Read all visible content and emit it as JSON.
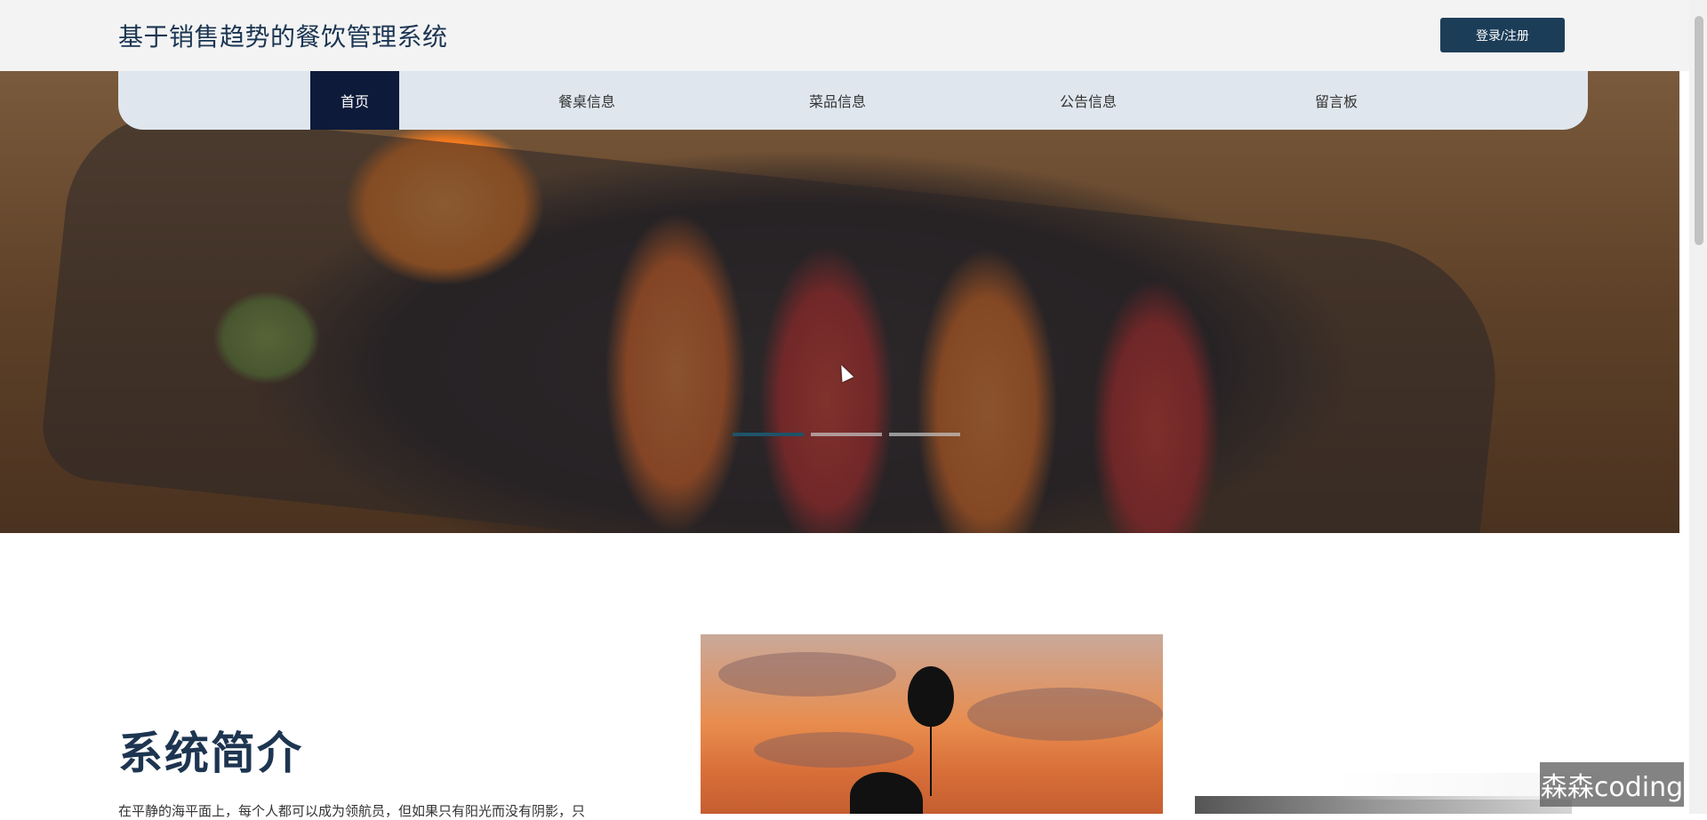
{
  "header": {
    "title": "基于销售趋势的餐饮管理系统",
    "login_label": "登录/注册"
  },
  "nav": {
    "items": [
      {
        "label": "首页",
        "active": true
      },
      {
        "label": "餐桌信息",
        "active": false
      },
      {
        "label": "菜品信息",
        "active": false
      },
      {
        "label": "公告信息",
        "active": false
      },
      {
        "label": "留言板",
        "active": false
      }
    ]
  },
  "carousel": {
    "slide_count": 3,
    "active_index": 0
  },
  "intro": {
    "title": "系统简介",
    "text": "在平静的海平面上，每个人都可以成为领航员，但如果只有阳光而没有阴影，只"
  },
  "watermark": {
    "text": "森森coding"
  },
  "colors": {
    "header_bg": "#f3f3f3",
    "title_color": "#1a3552",
    "button_bg": "#1c3d58",
    "nav_bg": "#dfe6ed",
    "nav_active_bg": "#0e1a3a",
    "dot_active": "#1f5368"
  }
}
